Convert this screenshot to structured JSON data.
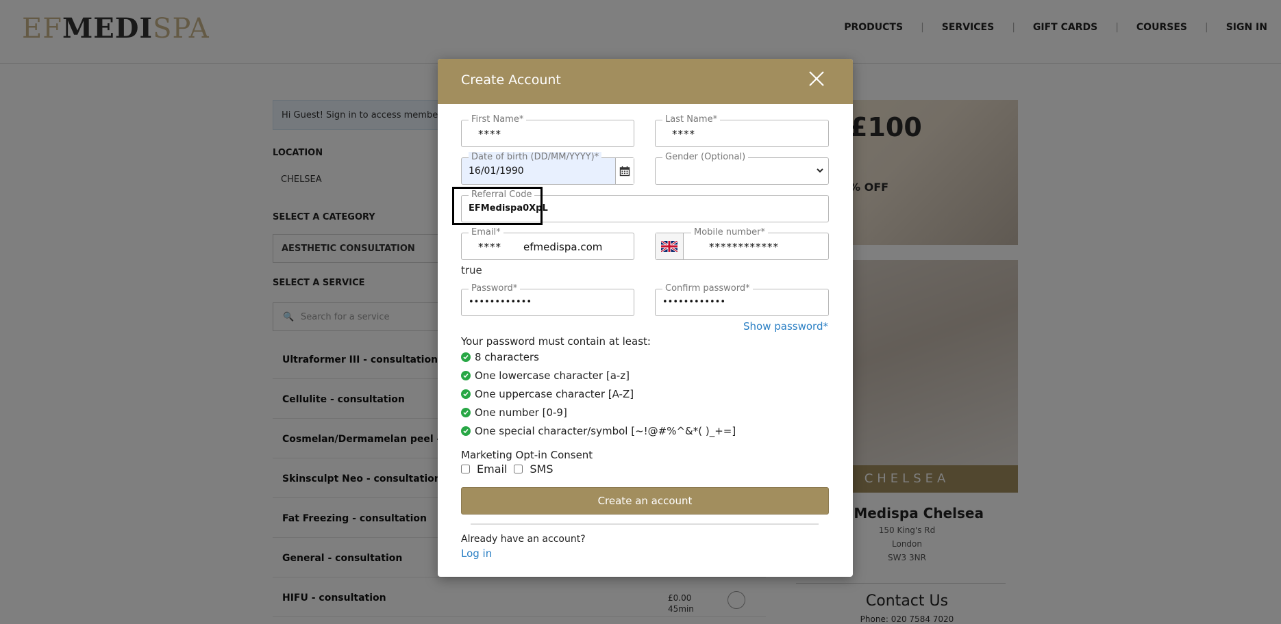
{
  "colors": {
    "brand": "#a28e5e",
    "success": "#28a745",
    "link": "#2a7fc4"
  },
  "background": {
    "logo": {
      "part1": "EF",
      "part2": "MEDI",
      "part3": "SPA"
    },
    "nav": [
      "PRODUCTS",
      "SERVICES",
      "GIFT CARDS",
      "COURSES",
      "SIGN IN"
    ],
    "info_bar": "Hi Guest! Sign in to access member",
    "location_label": "LOCATION",
    "location_value": "CHELSEA",
    "category_label": "SELECT A CATEGORY",
    "category_value": "AESTHETIC CONSULTATION",
    "service_label": "SELECT A SERVICE",
    "search_placeholder": "Search for a service",
    "services": [
      "Ultraformer III - consultation",
      "Cellulite - consultation",
      "Cosmelan/Dermamelan peel - co",
      "Skinsculpt Neo - consultation",
      "Fat Freezing - consultation",
      "General - consultation",
      "HIFU - consultation"
    ],
    "price": "£0.00",
    "duration": "45min",
    "promo_big": "£100",
    "promo_small": "% OFF",
    "clinic_banner": "CHELSEA",
    "clinic_name": "EF Medispa Chelsea",
    "clinic_address": [
      "150 King's Rd",
      "London",
      "SW3 3NR"
    ],
    "contact_title": "Contact Us",
    "phone_label": "Phone: 020 7584 7020"
  },
  "modal": {
    "title": "Create Account",
    "fields": {
      "first_name": {
        "label": "First Name*",
        "value": "****"
      },
      "last_name": {
        "label": "Last Name*",
        "value": "****"
      },
      "dob": {
        "label": "Date of birth (DD/MM/YYYY)*",
        "value": "16/01/1990"
      },
      "gender": {
        "label": "Gender (Optional)",
        "value": ""
      },
      "referral": {
        "label": "Referral Code",
        "value": "EFMedispa0XpL"
      },
      "email": {
        "label": "Email*",
        "value_masked": "****",
        "value_visible": "efmedispa.com"
      },
      "mobile": {
        "label": "Mobile number*",
        "value": "************"
      },
      "password": {
        "label": "Password*",
        "value": "••••••••••••"
      },
      "confirm_password": {
        "label": "Confirm password*",
        "value": "••••••••••••"
      }
    },
    "true_text": "true",
    "show_password": "Show password*",
    "password_rules_title": "Your password must contain at least:",
    "password_rules": [
      "8 characters",
      "One lowercase character [a-z]",
      "One uppercase character [A-Z]",
      "One number [0-9]",
      "One special character/symbol [~!@#%^&*( )_+=]"
    ],
    "consent_title": "Marketing Opt-in Consent",
    "consent_email": "Email",
    "consent_sms": "SMS",
    "create_button": "Create an account",
    "already_account": "Already have an account?",
    "login_link": "Log in"
  }
}
